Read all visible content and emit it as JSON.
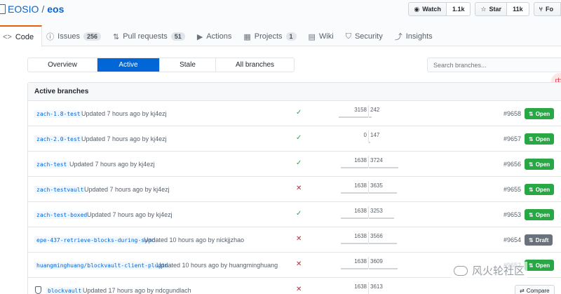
{
  "repo": {
    "owner": "EOSIO",
    "separator": "/",
    "name": "eos"
  },
  "actions": {
    "watch_label": "Watch",
    "watch_count": "1.1k",
    "star_label": "Star",
    "star_count": "11k",
    "fork_label": "Fo"
  },
  "tabs": [
    {
      "icon": "<>",
      "label": "Code"
    },
    {
      "icon": "ⓘ",
      "label": "Issues",
      "count": "256"
    },
    {
      "icon": "⇅",
      "label": "Pull requests",
      "count": "51"
    },
    {
      "icon": "▶",
      "label": "Actions"
    },
    {
      "icon": "▦",
      "label": "Projects",
      "count": "1"
    },
    {
      "icon": "▤",
      "label": "Wiki"
    },
    {
      "icon": "⛉",
      "label": "Security"
    },
    {
      "icon": "⤴",
      "label": "Insights"
    }
  ],
  "subnav": [
    "Overview",
    "Active",
    "Stale",
    "All branches"
  ],
  "search": {
    "placeholder": "Search branches..."
  },
  "float_badge": "中",
  "box_title": "Active branches",
  "branches": [
    {
      "name": "zach-1.8-test",
      "updated": "Updated 7 hours ago by kj4ezj",
      "status": "✓",
      "behind": "3158",
      "ahead": "242",
      "pr": "#9658",
      "pill": "Open"
    },
    {
      "name": "zach-2.0-test",
      "updated": "Updated 7 hours ago by kj4ezj",
      "status": "✓",
      "behind": "0",
      "ahead": "147",
      "pr": "#9657",
      "pill": "Open"
    },
    {
      "name": "zach-test",
      "updated": "Updated 7 hours ago by kj4ezj",
      "status": "✓",
      "behind": "1638",
      "ahead": "3724",
      "pr": "#9656",
      "pill": "Open"
    },
    {
      "name": "zach-testvault",
      "updated": "Updated 7 hours ago by kj4ezj",
      "status": "✕",
      "behind": "1638",
      "ahead": "3635",
      "pr": "#9655",
      "pill": "Open"
    },
    {
      "name": "zach-test-boxed",
      "updated": "Updated 7 hours ago by kj4ezj",
      "status": "✓",
      "behind": "1638",
      "ahead": "3253",
      "pr": "#9653",
      "pill": "Open"
    },
    {
      "name": "epe-437-retrieve-blocks-during-sync",
      "updated": "Updated 10 hours ago by nickjjzhao",
      "status": "✕",
      "behind": "1638",
      "ahead": "3566",
      "pr": "#9654",
      "pill": "Draft"
    },
    {
      "name": "huangminghuang/blockvault-client-plugin",
      "updated": "Updated 10 hours ago by huangminghuang",
      "status": "✕",
      "behind": "1638",
      "ahead": "3609",
      "pr": "#9652",
      "pill": "Open"
    },
    {
      "name": "blockvault",
      "updated": "Updated 17 hours ago by ndcgundlach",
      "status": "✕",
      "behind": "1638",
      "ahead": "3613",
      "pr": "",
      "pill": "Compare"
    }
  ],
  "watermark": "风火轮社区"
}
